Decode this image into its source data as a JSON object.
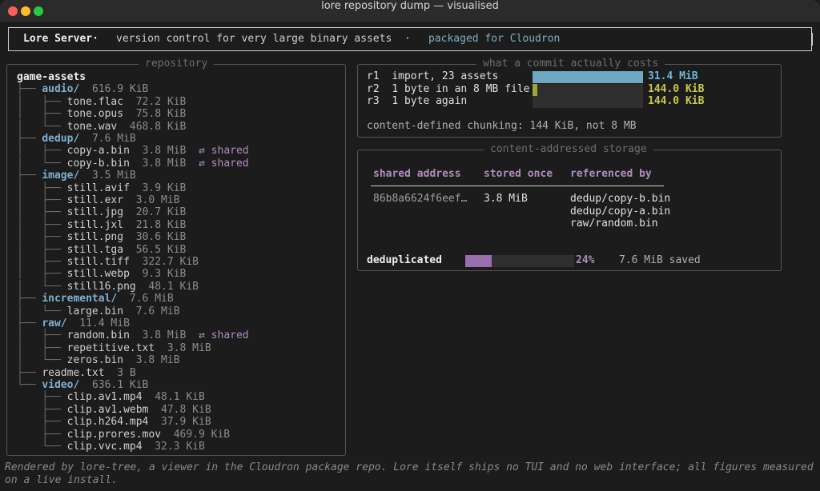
{
  "window": {
    "title": "lore repository dump — visualised"
  },
  "header": {
    "app": "Lore Server·",
    "description": "version control for very large binary assets",
    "separator": "·",
    "packaged": "packaged for Cloudron"
  },
  "repository": {
    "title": "repository",
    "root": "game-assets",
    "lines": [
      {
        "guide": "├── ",
        "name": "audio/",
        "size": "616.9 KiB",
        "type": "dir"
      },
      {
        "guide": "│   ├── ",
        "name": "tone.flac",
        "size": "72.2 KiB",
        "type": "file"
      },
      {
        "guide": "│   ├── ",
        "name": "tone.opus",
        "size": "75.8 KiB",
        "type": "file"
      },
      {
        "guide": "│   └── ",
        "name": "tone.wav",
        "size": "468.8 KiB",
        "type": "file"
      },
      {
        "guide": "├── ",
        "name": "dedup/",
        "size": "7.6 MiB",
        "type": "dir"
      },
      {
        "guide": "│   ├── ",
        "name": "copy-a.bin",
        "size": "3.8 MiB",
        "type": "file",
        "shared": "⇄ shared"
      },
      {
        "guide": "│   └── ",
        "name": "copy-b.bin",
        "size": "3.8 MiB",
        "type": "file",
        "shared": "⇄ shared"
      },
      {
        "guide": "├── ",
        "name": "image/",
        "size": "3.5 MiB",
        "type": "dir"
      },
      {
        "guide": "│   ├── ",
        "name": "still.avif",
        "size": "3.9 KiB",
        "type": "file"
      },
      {
        "guide": "│   ├── ",
        "name": "still.exr",
        "size": "3.0 MiB",
        "type": "file"
      },
      {
        "guide": "│   ├── ",
        "name": "still.jpg",
        "size": "20.7 KiB",
        "type": "file"
      },
      {
        "guide": "│   ├── ",
        "name": "still.jxl",
        "size": "21.8 KiB",
        "type": "file"
      },
      {
        "guide": "│   ├── ",
        "name": "still.png",
        "size": "30.6 KiB",
        "type": "file"
      },
      {
        "guide": "│   ├── ",
        "name": "still.tga",
        "size": "56.5 KiB",
        "type": "file"
      },
      {
        "guide": "│   ├── ",
        "name": "still.tiff",
        "size": "322.7 KiB",
        "type": "file"
      },
      {
        "guide": "│   ├── ",
        "name": "still.webp",
        "size": "9.3 KiB",
        "type": "file"
      },
      {
        "guide": "│   └── ",
        "name": "still16.png",
        "size": "48.1 KiB",
        "type": "file"
      },
      {
        "guide": "├── ",
        "name": "incremental/",
        "size": "7.6 MiB",
        "type": "dir"
      },
      {
        "guide": "│   └── ",
        "name": "large.bin",
        "size": "7.6 MiB",
        "type": "file"
      },
      {
        "guide": "├── ",
        "name": "raw/",
        "size": "11.4 MiB",
        "type": "dir"
      },
      {
        "guide": "│   ├── ",
        "name": "random.bin",
        "size": "3.8 MiB",
        "type": "file",
        "shared": "⇄ shared"
      },
      {
        "guide": "│   ├── ",
        "name": "repetitive.txt",
        "size": "3.8 MiB",
        "type": "file"
      },
      {
        "guide": "│   └── ",
        "name": "zeros.bin",
        "size": "3.8 MiB",
        "type": "file"
      },
      {
        "guide": "├── ",
        "name": "readme.txt",
        "size": "3 B",
        "type": "file"
      },
      {
        "guide": "└── ",
        "name": "video/",
        "size": "636.1 KiB",
        "type": "dir"
      },
      {
        "guide": "    ├── ",
        "name": "clip.av1.mp4",
        "size": "48.1 KiB",
        "type": "file"
      },
      {
        "guide": "    ├── ",
        "name": "clip.av1.webm",
        "size": "47.8 KiB",
        "type": "file"
      },
      {
        "guide": "    ├── ",
        "name": "clip.h264.mp4",
        "size": "37.9 KiB",
        "type": "file"
      },
      {
        "guide": "    ├── ",
        "name": "clip.prores.mov",
        "size": "469.9 KiB",
        "type": "file"
      },
      {
        "guide": "    └── ",
        "name": "clip.vvc.mp4",
        "size": "32.3 KiB",
        "type": "file"
      }
    ]
  },
  "commits": {
    "title": "what a commit actually costs",
    "rows": [
      {
        "label": "r1  import, 23 assets",
        "value": "31.4 MiB",
        "fraction": 1.0,
        "color": "#6fa8c0"
      },
      {
        "label": "r2  1 byte in an 8 MB file",
        "value": "144.0 KiB",
        "fraction": 0.045,
        "color": "#9aa83a"
      },
      {
        "label": "r3  1 byte again",
        "value": "144.0 KiB",
        "fraction": 0.0,
        "color": "#9aa83a"
      }
    ],
    "value_color": "#c8c850",
    "first_value_color": "#6fb8d8",
    "note": "content-defined chunking: 144 KiB, not 8 MB"
  },
  "storage": {
    "title": "content-addressed storage",
    "headers": {
      "address": "shared address",
      "stored": "stored once",
      "refs": "referenced by"
    },
    "row": {
      "address": "86b8a6624f6eef…",
      "stored": "3.8 MiB",
      "refs": [
        "dedup/copy-b.bin",
        "dedup/copy-a.bin",
        "raw/random.bin"
      ]
    },
    "dedup": {
      "label": "deduplicated",
      "percent": "24%",
      "fraction": 0.24,
      "saved": "7.6 MiB saved"
    }
  },
  "footer": "Rendered by lore-tree, a viewer in the Cloudron package repo. Lore itself ships no TUI and no web interface; all figures measured on a live install."
}
